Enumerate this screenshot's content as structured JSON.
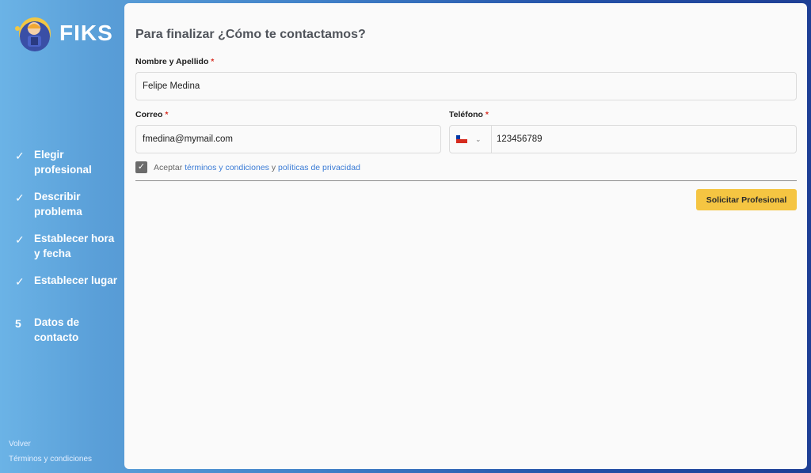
{
  "brand": {
    "name": "FIKS"
  },
  "steps": [
    {
      "marker": "✓",
      "label": "Elegir profesional"
    },
    {
      "marker": "✓",
      "label": "Describir problema"
    },
    {
      "marker": "✓",
      "label": "Establecer hora y fecha"
    },
    {
      "marker": "✓",
      "label": "Establecer lugar"
    },
    {
      "marker": "5",
      "label": "Datos de contacto"
    }
  ],
  "side_links": {
    "back": "Volver",
    "terms": "Términos y condiciones"
  },
  "form": {
    "title": "Para finalizar ¿Cómo te contactamos?",
    "name_label": "Nombre y Apellido",
    "name_value": "Felipe Medina",
    "email_label": "Correo",
    "email_value": "fmedina@mymail.com",
    "phone_label": "Teléfono",
    "phone_country": "CL",
    "phone_value": "123456789",
    "required_mark": "*",
    "accept_prefix": "Aceptar",
    "terms_link": "términos y condiciones",
    "and_text": "y",
    "privacy_link": "políticas de privacidad",
    "accept_checked": true,
    "submit_label": "Solicitar Profesional"
  },
  "colors": {
    "accent": "#f5c542",
    "link": "#3a7bd5",
    "required": "#d93025"
  }
}
